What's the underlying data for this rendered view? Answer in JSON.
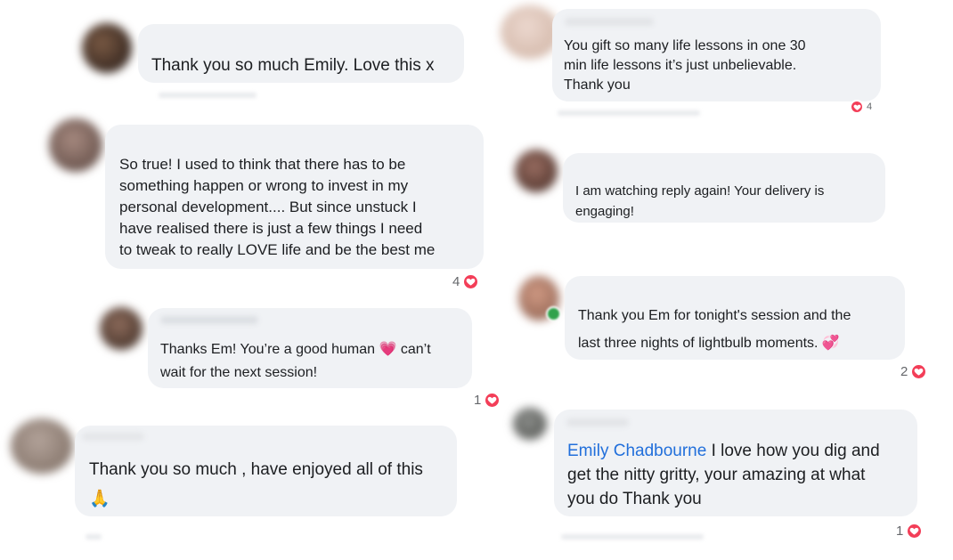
{
  "comments": [
    {
      "id": "c1",
      "text": "Thank you so much Emily. Love this x"
    },
    {
      "id": "c2",
      "text": "So true! I used to think that there has to be\nsomething happen or wrong to invest in my\npersonal development.... But since unstuck I\nhave realised there is just a few things I need\nto tweak to really LOVE life and be the best me",
      "reactions": "4"
    },
    {
      "id": "c3",
      "text_before": "Thanks Em! You’re a good human ",
      "emoji": "💗",
      "text_after": " can’t\nwait for the next session!",
      "reactions": "1"
    },
    {
      "id": "c4",
      "text": "Thank you so much , have enjoyed all of this\n",
      "emoji": "🙏"
    },
    {
      "id": "c5",
      "text": "You gift so many life lessons in one 30\nmin life lessons it’s just unbelievable.\nThank you",
      "reactions": "4"
    },
    {
      "id": "c6",
      "text": "I am watching reply again! Your delivery is\nengaging!"
    },
    {
      "id": "c7",
      "text": "Thank you Em for tonight's session and the\nlast three nights of lightbulb moments.  ",
      "emoji": "💞",
      "reactions": "2"
    },
    {
      "id": "c8",
      "mention": "Emily Chadbourne",
      "text": " I love how you dig and\nget the nitty gritty, your amazing at what\nyou do Thank you",
      "reactions": "1"
    }
  ],
  "colors": {
    "bubble": "#f0f2f5",
    "heart": "#f33e58",
    "mention": "#216fdb",
    "reaction_count": "#65676b"
  },
  "icons": {
    "reaction": "heart-icon"
  }
}
